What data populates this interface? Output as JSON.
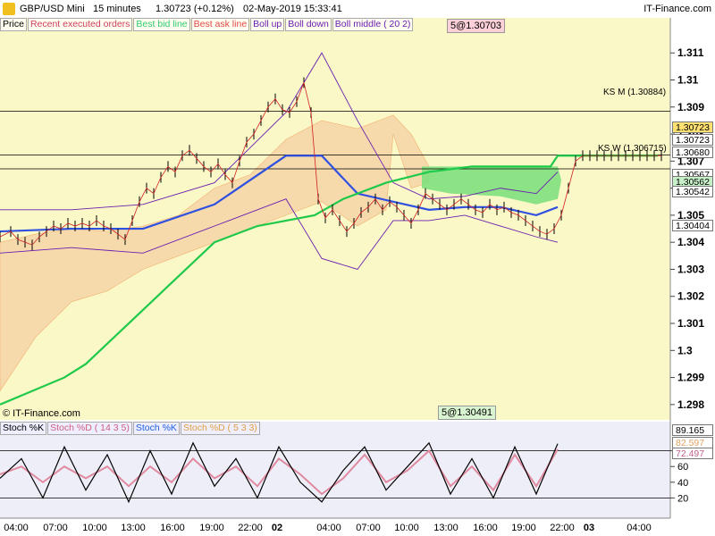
{
  "header": {
    "symbol": "GBP/USD Mini",
    "timeframe": "15 minutes",
    "quote": "1.30723 (+0.12%)",
    "datetime": "02-May-2019 15:33:41",
    "brand": "IT-Finance.com"
  },
  "legend": [
    {
      "label": "Price",
      "color": "#000000"
    },
    {
      "label": "Recent executed orders",
      "color": "#d04060"
    },
    {
      "label": "Best bid line",
      "color": "#2ecc71"
    },
    {
      "label": "Best ask line",
      "color": "#e04848"
    },
    {
      "label": "Boll up",
      "color": "#6a1fb0"
    },
    {
      "label": "Boll down",
      "color": "#6a1fb0"
    },
    {
      "label": "Boll middle ( 20 2)",
      "color": "#6a1fb0"
    }
  ],
  "order_badges": {
    "top": "5@1.30703",
    "bottom": "5@1.30491"
  },
  "watermark": "© IT-Finance.com",
  "ks_labels": {
    "m": "KS M (1.30884)",
    "w": "KS W (1.306715)"
  },
  "price_boxes": [
    {
      "label": "1.30723",
      "bg": "#ffe070"
    },
    {
      "label": "1.30723",
      "bg": "#ffffff"
    },
    {
      "label": "1.30680",
      "bg": "#ffffff"
    },
    {
      "label": "1.30567",
      "bg": "#ffffff"
    },
    {
      "label": "1.30562",
      "bg": "#c8f0c8"
    },
    {
      "label": "1.30542",
      "bg": "#ffffff"
    },
    {
      "label": "1.30404",
      "bg": "#ffffff"
    }
  ],
  "stoch_legend": [
    "Stoch %K",
    "Stoch %D ( 14 3 5)",
    "Stoch %K",
    "Stoch %D ( 5 3 3)"
  ],
  "stoch_boxes": [
    {
      "label": "89.165",
      "bg": "#ffffff",
      "color": "#000000"
    },
    {
      "label": "82.597",
      "bg": "#ffffff",
      "color": "#e0a060"
    },
    {
      "label": "72.497",
      "bg": "#ffffff",
      "color": "#c0608c"
    }
  ],
  "colors": {
    "bg_main": "#fbf8c7",
    "bg_stoch": "#eeeef8",
    "cloud": "#f5c79a",
    "bid": "#1fc94a",
    "ask": "#e03030",
    "boll": "#6a1fb0",
    "ks": "#3050e0",
    "price": "#000000"
  },
  "chart_data": [
    {
      "type": "line",
      "title": "",
      "ylim": [
        1.2975,
        1.3118
      ],
      "y_ticks": [
        "1.298",
        "1.299",
        "1.3",
        "1.301",
        "1.302",
        "1.303",
        "1.304",
        "1.305",
        "1.306",
        "1.307",
        "1.308",
        "1.309",
        "1.31",
        "1.311"
      ],
      "x_ticks": [
        "04:00",
        "07:00",
        "10:00",
        "13:00",
        "16:00",
        "19:00",
        "22:00",
        "02",
        "04:00",
        "07:00",
        "10:00",
        "13:00",
        "16:00",
        "19:00",
        "22:00",
        "03",
        "04:00"
      ],
      "hlines": [
        {
          "name": "KS M",
          "value": 1.30884
        },
        {
          "name": "KS W",
          "value": 1.306715
        },
        {
          "name": "",
          "value": 1.30723
        }
      ],
      "series": [
        {
          "name": "Price",
          "x": [
            0,
            3,
            5,
            7,
            9,
            11,
            13,
            15,
            17,
            19,
            21,
            23,
            25,
            27,
            29,
            31,
            33,
            35,
            37,
            39,
            41,
            43,
            45,
            47,
            49,
            51,
            53,
            55,
            57,
            59,
            61,
            63,
            65,
            67,
            69,
            71,
            73,
            75,
            77,
            79,
            81,
            83,
            85,
            87,
            89,
            91,
            93,
            95,
            97,
            99,
            101,
            103,
            105,
            107,
            109,
            111,
            113,
            115,
            117,
            119,
            121,
            123,
            125,
            127,
            129,
            131,
            133,
            135,
            137,
            139,
            141,
            143,
            145,
            147,
            149,
            151,
            153,
            155,
            157,
            159,
            161,
            163,
            165,
            167,
            169,
            171,
            173,
            175,
            177,
            179,
            181,
            183,
            185
          ],
          "values": [
            1.3042,
            1.3044,
            1.3041,
            1.304,
            1.3039,
            1.3042,
            1.3044,
            1.3046,
            1.3045,
            1.3047,
            1.3046,
            1.3047,
            1.3046,
            1.3048,
            1.3046,
            1.3045,
            1.3043,
            1.3041,
            1.3048,
            1.3055,
            1.306,
            1.3058,
            1.3064,
            1.3068,
            1.3066,
            1.3072,
            1.3074,
            1.3071,
            1.3068,
            1.3066,
            1.3069,
            1.3065,
            1.3062,
            1.307,
            1.3077,
            1.308,
            1.3085,
            1.309,
            1.3093,
            1.3089,
            1.3088,
            1.3092,
            1.3099,
            1.3088,
            1.3056,
            1.3049,
            1.3052,
            1.3048,
            1.3044,
            1.3047,
            1.3051,
            1.3053,
            1.3056,
            1.3052,
            1.3055,
            1.3053,
            1.305,
            1.3047,
            1.3052,
            1.3058,
            1.3056,
            1.3054,
            1.3052,
            1.3054,
            1.3056,
            1.3054,
            1.3052,
            1.3051,
            1.3054,
            1.3052,
            1.3053,
            1.3051,
            1.305,
            1.3048,
            1.3046,
            1.3044,
            1.3043,
            1.3045,
            1.305,
            1.306,
            1.307,
            1.3072,
            1.3072,
            1.3072,
            1.3072,
            1.3072,
            1.3072,
            1.3072,
            1.3072,
            1.3072,
            1.3072,
            1.3072,
            1.3072
          ]
        },
        {
          "name": "Best bid line",
          "x": [
            0,
            18,
            24,
            36,
            48,
            60,
            72,
            88,
            96,
            108,
            120,
            132,
            144,
            154,
            156,
            160,
            168,
            176,
            184
          ],
          "values": [
            1.298,
            1.299,
            1.2995,
            1.301,
            1.3025,
            1.304,
            1.3046,
            1.305,
            1.3056,
            1.3062,
            1.3066,
            1.3068,
            1.3068,
            1.3068,
            1.3072,
            1.3072,
            1.3072,
            1.3072,
            1.3072
          ]
        },
        {
          "name": "Boll up",
          "x": [
            0,
            20,
            40,
            60,
            80,
            90,
            100,
            110,
            120,
            130,
            140,
            150,
            156
          ],
          "values": [
            1.3052,
            1.3052,
            1.3054,
            1.3062,
            1.3088,
            1.311,
            1.3085,
            1.3062,
            1.3056,
            1.3057,
            1.306,
            1.3058,
            1.3066
          ]
        },
        {
          "name": "Boll down",
          "x": [
            0,
            20,
            40,
            60,
            80,
            90,
            100,
            110,
            120,
            130,
            140,
            150,
            156
          ],
          "values": [
            1.3036,
            1.3038,
            1.3036,
            1.3046,
            1.3056,
            1.3034,
            1.303,
            1.3048,
            1.3048,
            1.305,
            1.3046,
            1.3042,
            1.304
          ]
        },
        {
          "name": "Boll middle",
          "x": [
            0,
            20,
            40,
            60,
            80,
            90,
            100,
            110,
            120,
            130,
            140,
            150,
            156
          ],
          "values": [
            1.3044,
            1.3045,
            1.3045,
            1.3054,
            1.3072,
            1.3072,
            1.3058,
            1.3055,
            1.3052,
            1.3053,
            1.3053,
            1.305,
            1.3053
          ]
        }
      ]
    },
    {
      "type": "line",
      "title": "",
      "ylim": [
        0,
        100
      ],
      "y_ticks": [
        "20",
        "40",
        "60",
        "80"
      ],
      "hlines": [
        {
          "name": "",
          "value": 80
        },
        {
          "name": "",
          "value": 20
        }
      ],
      "series": [
        {
          "name": "Stoch %K",
          "x": [
            0,
            6,
            12,
            18,
            24,
            30,
            36,
            42,
            48,
            54,
            60,
            66,
            72,
            78,
            84,
            90,
            96,
            102,
            108,
            114,
            120,
            126,
            132,
            138,
            144,
            150,
            156
          ],
          "values": [
            45,
            70,
            20,
            85,
            30,
            75,
            15,
            80,
            25,
            90,
            35,
            70,
            20,
            85,
            40,
            15,
            55,
            85,
            30,
            60,
            90,
            25,
            70,
            20,
            85,
            25,
            89
          ]
        },
        {
          "name": "Stoch %D",
          "x": [
            0,
            6,
            12,
            18,
            24,
            30,
            36,
            42,
            48,
            54,
            60,
            66,
            72,
            78,
            84,
            90,
            96,
            102,
            108,
            114,
            120,
            126,
            132,
            138,
            144,
            150,
            156
          ],
          "values": [
            50,
            60,
            40,
            60,
            45,
            60,
            35,
            60,
            40,
            70,
            45,
            60,
            35,
            70,
            50,
            25,
            45,
            75,
            40,
            55,
            80,
            35,
            60,
            30,
            75,
            35,
            82
          ]
        }
      ]
    }
  ]
}
